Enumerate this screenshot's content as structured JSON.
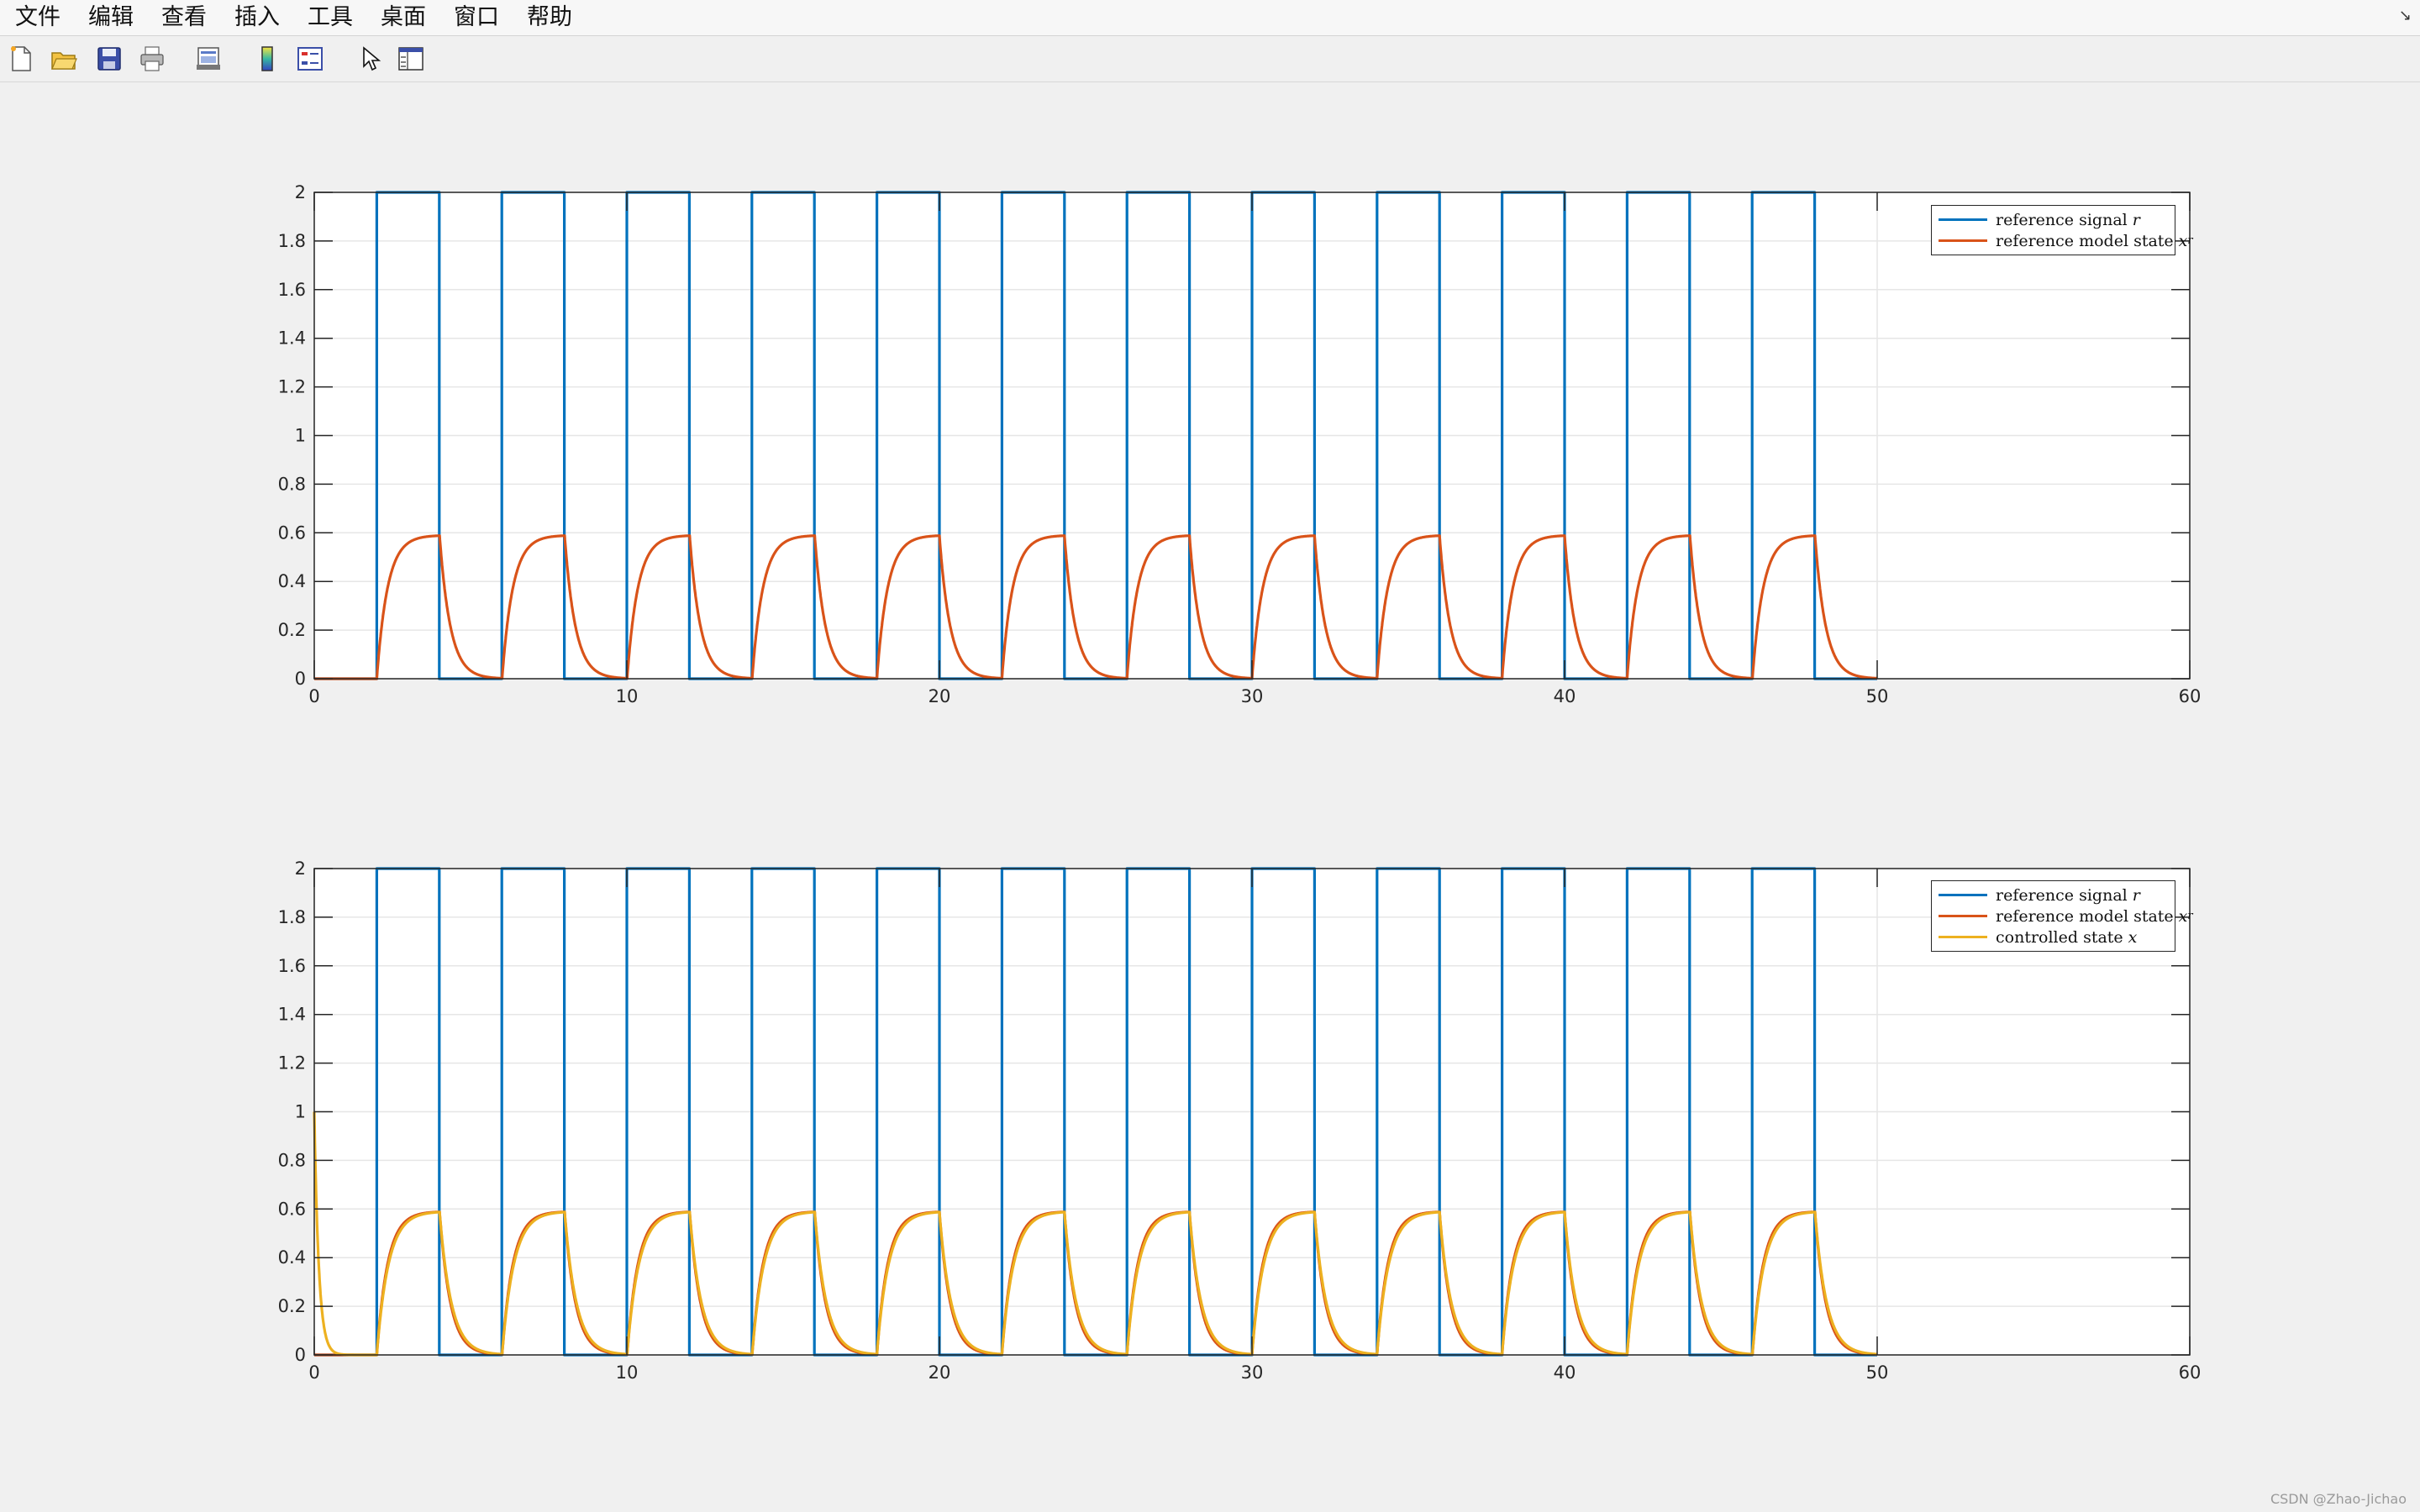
{
  "menu": [
    "文件",
    "编辑",
    "查看",
    "插入",
    "工具",
    "桌面",
    "窗口",
    "帮助"
  ],
  "menu_corner": "↘",
  "toolbar": {
    "icons": [
      "new-figure-icon",
      "open-file-icon",
      "save-icon",
      "print-icon",
      "print-preview-icon",
      "colorbar-icon",
      "legend-icon",
      "pointer-icon",
      "property-editor-icon"
    ]
  },
  "colors": {
    "reference": "#0072BD",
    "model": "#D95319",
    "controlled": "#EDB120"
  },
  "watermark": "CSDN @Zhao-Jichao",
  "chart_data": [
    {
      "type": "line",
      "xlim": [
        0,
        60
      ],
      "ylim": [
        0,
        2
      ],
      "xticks": [
        "0",
        "10",
        "20",
        "30",
        "40",
        "50",
        "60"
      ],
      "yticks": [
        "0",
        "0.2",
        "0.4",
        "0.6",
        "0.8",
        "1",
        "1.2",
        "1.4",
        "1.6",
        "1.8",
        "2"
      ],
      "grid": true,
      "legend_position": "top-right",
      "series": [
        {
          "name": "reference signal",
          "symbol": "r",
          "kind": "square-wave",
          "low": 0,
          "high": 2,
          "period": 4,
          "high_start": 2,
          "high_duration": 2,
          "x_end": 50
        },
        {
          "name": "reference model state",
          "symbol": "x",
          "subscript": "r",
          "kind": "first-order-response",
          "steady_state": 0.59,
          "time_constant": 0.35,
          "initial": 0,
          "x_end": 50
        }
      ]
    },
    {
      "type": "line",
      "xlim": [
        0,
        60
      ],
      "ylim": [
        0,
        2
      ],
      "xticks": [
        "0",
        "10",
        "20",
        "30",
        "40",
        "50",
        "60"
      ],
      "yticks": [
        "0",
        "0.2",
        "0.4",
        "0.6",
        "0.8",
        "1",
        "1.2",
        "1.4",
        "1.6",
        "1.8",
        "2"
      ],
      "grid": true,
      "legend_position": "top-right",
      "series": [
        {
          "name": "reference signal",
          "symbol": "r",
          "kind": "square-wave",
          "low": 0,
          "high": 2,
          "period": 4,
          "high_start": 2,
          "high_duration": 2,
          "x_end": 50
        },
        {
          "name": "reference model state",
          "symbol": "x",
          "subscript": "r",
          "kind": "first-order-response",
          "steady_state": 0.59,
          "time_constant": 0.35,
          "initial": 0,
          "x_end": 50
        },
        {
          "name": "controlled state",
          "symbol": "x",
          "kind": "first-order-response",
          "steady_state": 0.59,
          "time_constant": 0.38,
          "initial": 1,
          "initial_decay": 0.15,
          "x_end": 50
        }
      ]
    }
  ]
}
